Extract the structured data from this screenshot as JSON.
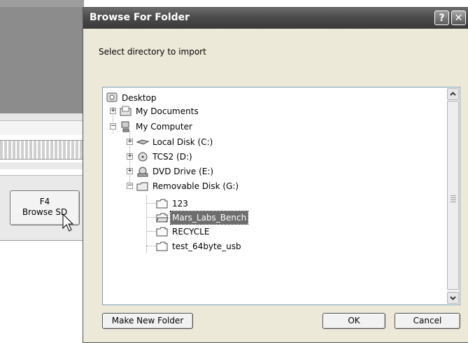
{
  "background_app": {
    "f4_key": "F4",
    "f4_label": "Browse SD"
  },
  "dialog": {
    "title": "Browse For Folder",
    "help_glyph": "?",
    "close_glyph": "✕",
    "instruction": "Select directory to import",
    "tree": {
      "root": "Desktop",
      "my_documents": "My Documents",
      "my_computer": "My Computer",
      "drive_c": "Local Disk (C:)",
      "drive_d": "TCS2 (D:)",
      "drive_e": "DVD Drive (E:)",
      "drive_g": "Removable Disk (G:)",
      "folders": [
        "123",
        "Mars_Labs_Bench",
        "RECYCLE",
        "test_64byte_usb"
      ],
      "selected_folder": "Mars_Labs_Bench"
    },
    "buttons": {
      "make_new_folder": "Make New Folder",
      "ok": "OK",
      "cancel": "Cancel"
    }
  }
}
